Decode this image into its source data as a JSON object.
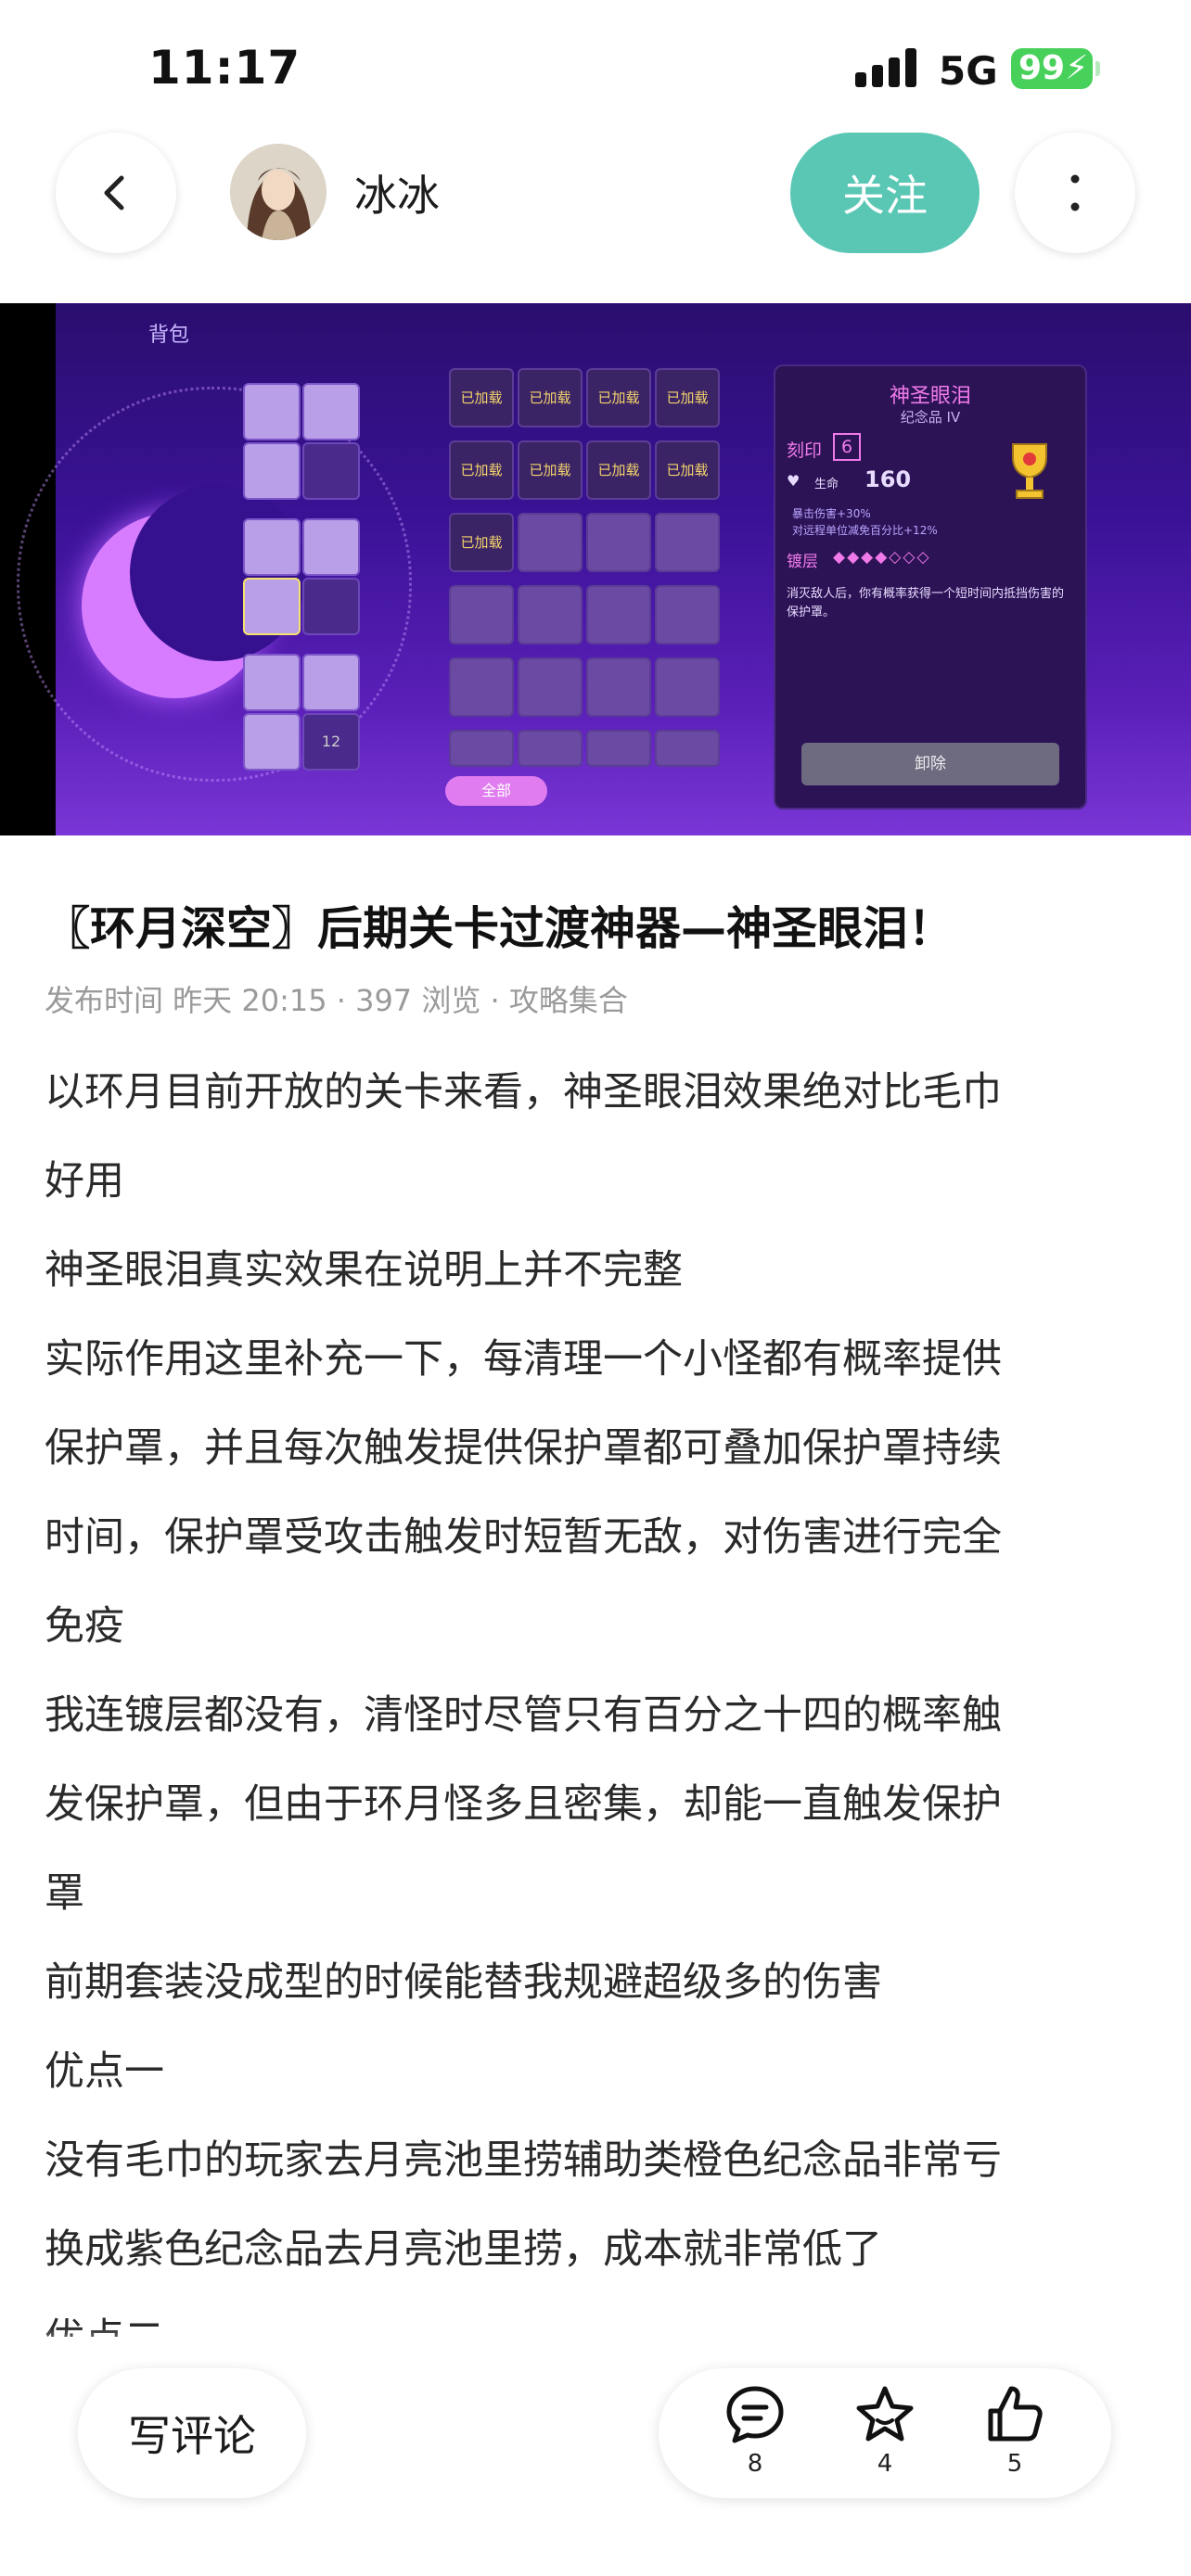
{
  "status_bar": {
    "time": "11:17",
    "network": "5G",
    "battery": "99"
  },
  "header": {
    "author_name": "冰冰",
    "follow_label": "关注"
  },
  "hero_image": {
    "bag_label": "背包",
    "equipped_label": "已加载",
    "all_button": "全部",
    "slot_count": "12",
    "panel": {
      "title": "神圣眼泪",
      "subtitle": "纪念品 IV",
      "imprint_label": "刻印",
      "imprint_value": "6",
      "life_label": "生命",
      "life_value": "160",
      "stat_1": "暴击伤害+30%",
      "stat_2": "对远程单位减免百分比+12%",
      "plating_label": "镀层",
      "description": "消灭敌人后，你有概率获得一个短时间内抵挡伤害的保护罩。",
      "unequip_button": "卸除"
    }
  },
  "article": {
    "title": "〖环月深空〗后期关卡过渡神器—神圣眼泪！",
    "meta": "发布时间 昨天 20:15 · 397 浏览 · 攻略集合",
    "lines": [
      "以环月目前开放的关卡来看，神圣眼泪效果绝对比毛巾",
      "好用",
      "神圣眼泪真实效果在说明上并不完整",
      "实际作用这里补充一下，每清理一个小怪都有概率提供",
      "保护罩，并且每次触发提供保护罩都可叠加保护罩持续",
      "时间，保护罩受攻击触发时短暂无敌，对伤害进行完全",
      "免疫",
      "我连镀层都没有，清怪时尽管只有百分之十四的概率触",
      "发保护罩，但由于环月怪多且密集，却能一直触发保护",
      "罩",
      "前期套装没成型的时候能替我规避超级多的伤害",
      "优点一",
      "没有毛巾的玩家去月亮池里捞辅助类橙色纪念品非常亏",
      "换成紫色纪念品去月亮池里捞，成本就非常低了",
      "优点二"
    ]
  },
  "bottom_bar": {
    "comment_button": "写评论",
    "comment_count": "8",
    "favorite_count": "4",
    "like_count": "5"
  }
}
